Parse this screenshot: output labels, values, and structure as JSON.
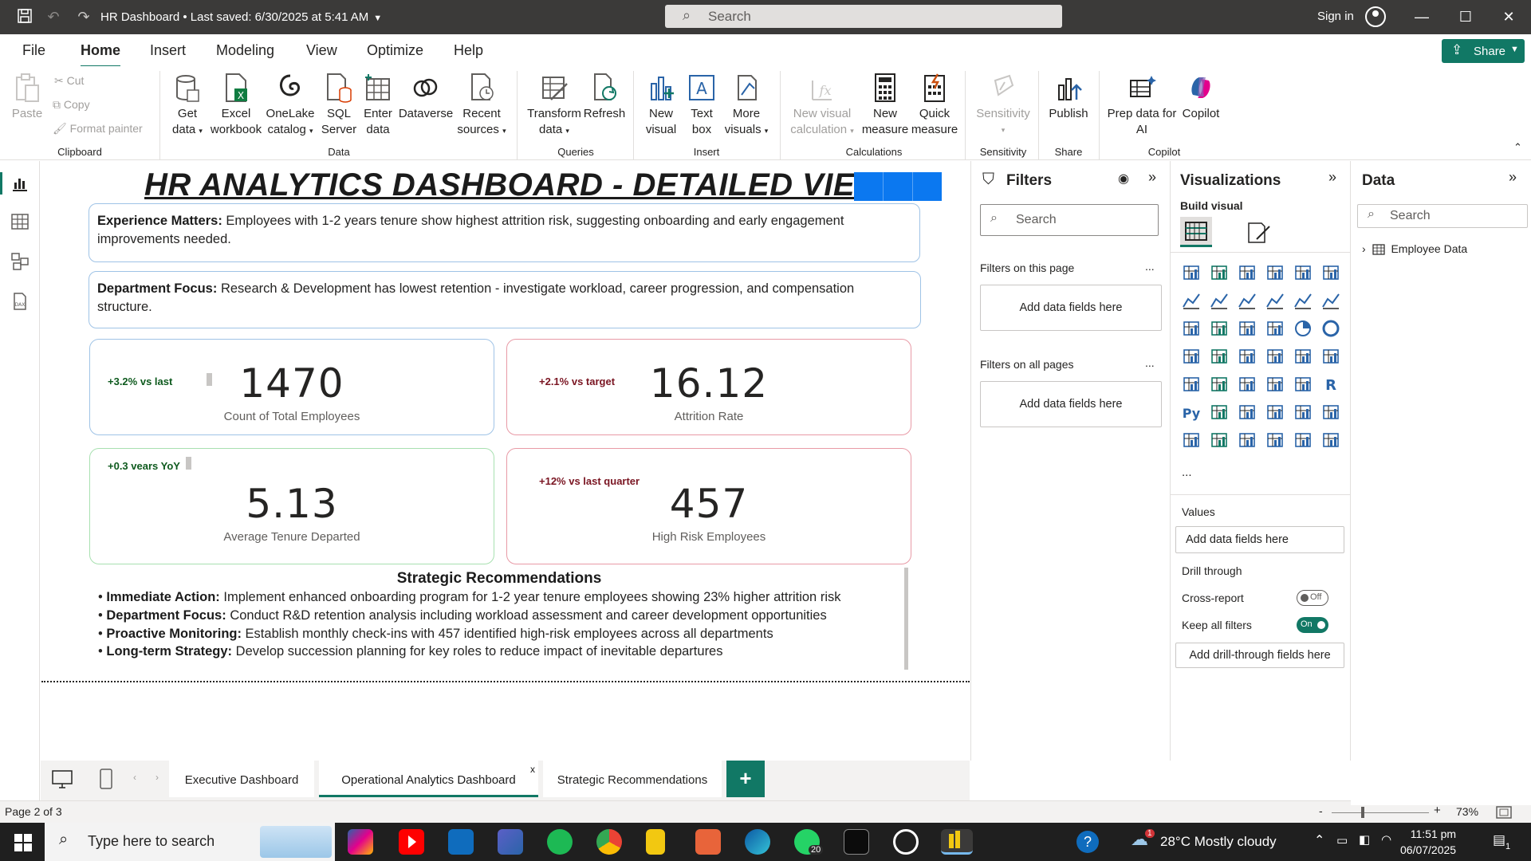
{
  "titlebar": {
    "doc_title": "HR Dashboard • Last saved: 6/30/2025 at 5:41 AM",
    "search_placeholder": "Search",
    "signin": "Sign in"
  },
  "menu": [
    "File",
    "Home",
    "Insert",
    "Modeling",
    "View",
    "Optimize",
    "Help"
  ],
  "share_label": "Share",
  "ribbon": {
    "clipboard": {
      "paste": "Paste",
      "cut": "Cut",
      "copy": "Copy",
      "format_painter": "Format painter",
      "group": "Clipboard"
    },
    "data": {
      "get_data": [
        "Get",
        "data"
      ],
      "excel": [
        "Excel",
        "workbook"
      ],
      "onelake": [
        "OneLake",
        "catalog"
      ],
      "sql": [
        "SQL",
        "Server"
      ],
      "enter": [
        "Enter",
        "data"
      ],
      "dataverse": [
        "Dataverse"
      ],
      "recent": [
        "Recent",
        "sources"
      ],
      "group": "Data"
    },
    "queries": {
      "transform": [
        "Transform",
        "data"
      ],
      "refresh": [
        "Refresh"
      ],
      "group": "Queries"
    },
    "insert": {
      "new_visual": [
        "New",
        "visual"
      ],
      "text_box": [
        "Text",
        "box"
      ],
      "more_visuals": [
        "More",
        "visuals"
      ],
      "group": "Insert"
    },
    "calculations": {
      "new_visual_calc": [
        "New visual",
        "calculation"
      ],
      "new_measure": [
        "New",
        "measure"
      ],
      "quick_measure": [
        "Quick",
        "measure"
      ],
      "group": "Calculations"
    },
    "sensitivity": {
      "label": [
        "Sensitivity"
      ],
      "group": "Sensitivity"
    },
    "share": {
      "publish": [
        "Publish"
      ],
      "group": "Share"
    },
    "copilot": {
      "prep": [
        "Prep data for",
        "AI"
      ],
      "copilot": [
        "Copilot"
      ],
      "group": "Copilot"
    }
  },
  "dashboard": {
    "title": "HR ANALYTICS DASHBOARD - DETAILED VIEW",
    "insights": [
      {
        "bold": "Experience Matters:",
        "text": " Employees with 1-2 years tenure show highest attrition risk, suggesting onboarding and early engagement improvements needed."
      },
      {
        "bold": "Department Focus:",
        "text": " Research & Development has lowest retention - investigate workload, career progression, and compensation structure."
      }
    ],
    "kpis": [
      {
        "delta": "+3.2% vs last",
        "value": "1470",
        "label": "Count of Total Employees"
      },
      {
        "delta": "+2.1% vs target",
        "value": "16.12",
        "label": "Attrition Rate"
      },
      {
        "delta": "+0.3 vears YoY",
        "value": "5.13",
        "label": "Average Tenure Departed"
      },
      {
        "delta": "+12% vs last quarter",
        "value": "457",
        "label": "High Risk Employees"
      }
    ],
    "recommendations": {
      "title": "Strategic Recommendations",
      "items": [
        {
          "bold": "Immediate Action:",
          "text": " Implement enhanced onboarding program for 1-2 year tenure employees showing 23% higher attrition risk"
        },
        {
          "bold": "Department Focus:",
          "text": " Conduct R&D retention analysis including workload assessment and career development opportunities"
        },
        {
          "bold": "Proactive Monitoring:",
          "text": " Establish monthly check-ins with 457 identified high-risk employees across all departments"
        },
        {
          "bold": "Long-term Strategy:",
          "text": " Develop succession planning for key roles to reduce impact of inevitable departures"
        }
      ]
    }
  },
  "pages": {
    "tabs": [
      "Executive Dashboard",
      "Operational Analytics Dashboard",
      "Strategic Recommendations"
    ],
    "active_close": "x",
    "add": "+",
    "indicator": "Page 2 of 3",
    "zoom": "73%"
  },
  "filters": {
    "title": "Filters",
    "search_placeholder": "Search",
    "this_page": "Filters on this page",
    "all_pages": "Filters on all pages",
    "add_fields": "Add data fields here",
    "more": "..."
  },
  "visualizations": {
    "title": "Visualizations",
    "build_visual": "Build visual",
    "values": "Values",
    "add_fields": "Add data fields here",
    "drill_through": "Drill through",
    "cross_report": "Cross-report",
    "cross_report_state": "Off",
    "keep_all_filters": "Keep all filters",
    "keep_all_state": "On",
    "add_drill": "Add drill-through fields here",
    "more": "...",
    "r_label": "R",
    "py_label": "Py"
  },
  "datapane": {
    "title": "Data",
    "search_placeholder": "Search",
    "table": "Employee Data"
  },
  "taskbar": {
    "search_placeholder": "Type here to search",
    "whatsapp_badge": "20",
    "weather": "28°C  Mostly cloudy",
    "weather_badge": "1",
    "time": "11:51 pm",
    "date": "06/07/2025",
    "notif_count": "1"
  },
  "colors": {
    "accent": "#117865",
    "titlebar": "#3b3a39",
    "kpi_blue_border": "#9fc3e6",
    "kpi_red_border": "#e89aa6",
    "kpi_green_border": "#a8e0b0",
    "delta_green": "#0e5a1e",
    "delta_red": "#7a1522",
    "blue_block": "#0b78f0"
  }
}
